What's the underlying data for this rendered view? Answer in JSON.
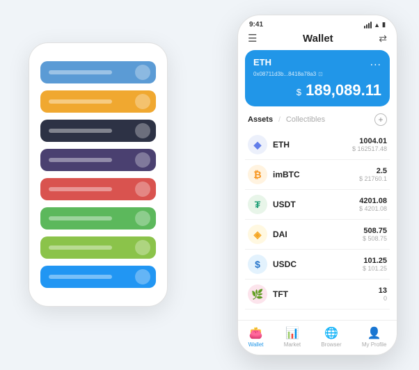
{
  "scene": {
    "bg_phone": {
      "cards": [
        {
          "id": "card-blue",
          "color": "#5b9bd5",
          "label": ""
        },
        {
          "id": "card-orange",
          "color": "#f0a830",
          "label": ""
        },
        {
          "id": "card-dark",
          "color": "#2d3245",
          "label": ""
        },
        {
          "id": "card-purple",
          "color": "#4a4070",
          "label": ""
        },
        {
          "id": "card-red",
          "color": "#d9534f",
          "label": ""
        },
        {
          "id": "card-green",
          "color": "#5cb85c",
          "label": ""
        },
        {
          "id": "card-lime",
          "color": "#8bc34a",
          "label": ""
        },
        {
          "id": "card-blue2",
          "color": "#2196f3",
          "label": ""
        }
      ]
    },
    "fg_phone": {
      "status_bar": {
        "time": "9:41",
        "signal": "▎▎▎",
        "wifi": "WiFi",
        "battery": "🔋"
      },
      "header": {
        "menu_icon": "☰",
        "title": "Wallet",
        "scan_icon": "⇄"
      },
      "wallet_card": {
        "coin": "ETH",
        "address": "0x08711d3b...8418a78a3",
        "copy_icon": "⊡",
        "amount_prefix": "$",
        "amount": "189,089.11",
        "dots": "..."
      },
      "assets_section": {
        "tab_active": "Assets",
        "divider": "/",
        "tab_inactive": "Collectibles",
        "add_icon": "+"
      },
      "assets": [
        {
          "symbol": "ETH",
          "icon_char": "◆",
          "icon_class": "eth-icon",
          "amount": "1004.01",
          "usd": "$ 162517.48"
        },
        {
          "symbol": "imBTC",
          "icon_char": "₿",
          "icon_class": "imbtc-icon",
          "amount": "2.5",
          "usd": "$ 21760.1"
        },
        {
          "symbol": "USDT",
          "icon_char": "₮",
          "icon_class": "usdt-icon",
          "amount": "4201.08",
          "usd": "$ 4201.08"
        },
        {
          "symbol": "DAI",
          "icon_char": "◈",
          "icon_class": "dai-icon",
          "amount": "508.75",
          "usd": "$ 508.75"
        },
        {
          "symbol": "USDC",
          "icon_char": "$",
          "icon_class": "usdc-icon",
          "amount": "101.25",
          "usd": "$ 101.25"
        },
        {
          "symbol": "TFT",
          "icon_char": "🌿",
          "icon_class": "tft-icon",
          "amount": "13",
          "usd": "0"
        }
      ],
      "nav": [
        {
          "id": "wallet",
          "icon": "👛",
          "label": "Wallet",
          "active": true
        },
        {
          "id": "market",
          "icon": "📊",
          "label": "Market",
          "active": false
        },
        {
          "id": "browser",
          "icon": "🌐",
          "label": "Browser",
          "active": false
        },
        {
          "id": "profile",
          "icon": "👤",
          "label": "My Profile",
          "active": false
        }
      ]
    }
  }
}
